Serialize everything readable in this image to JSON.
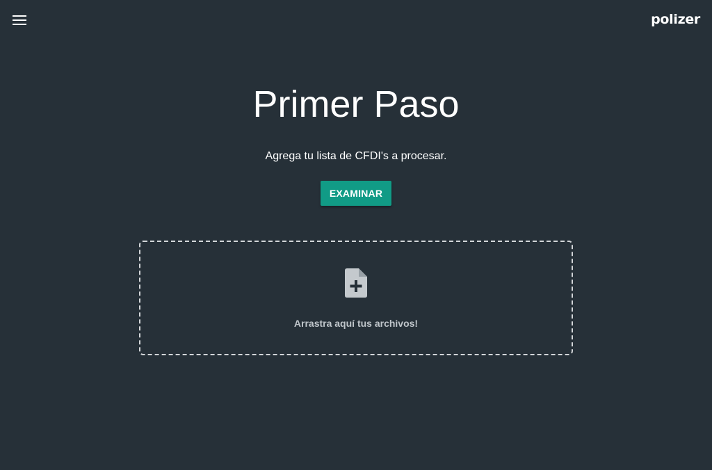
{
  "header": {
    "menu_icon": "hamburger-menu-icon",
    "brand": "polizer"
  },
  "main": {
    "title": "Primer Paso",
    "subtitle": "Agrega tu lista de CFDI's a procesar.",
    "browse_label": "EXAMINAR"
  },
  "dropzone": {
    "icon": "file-add-icon",
    "text": "Arrastra aquí tus archivos!"
  },
  "colors": {
    "background": "#263038",
    "accent": "#119b86",
    "dropzone_border": "#d3d6d9",
    "muted_text": "#bfc5ca"
  }
}
